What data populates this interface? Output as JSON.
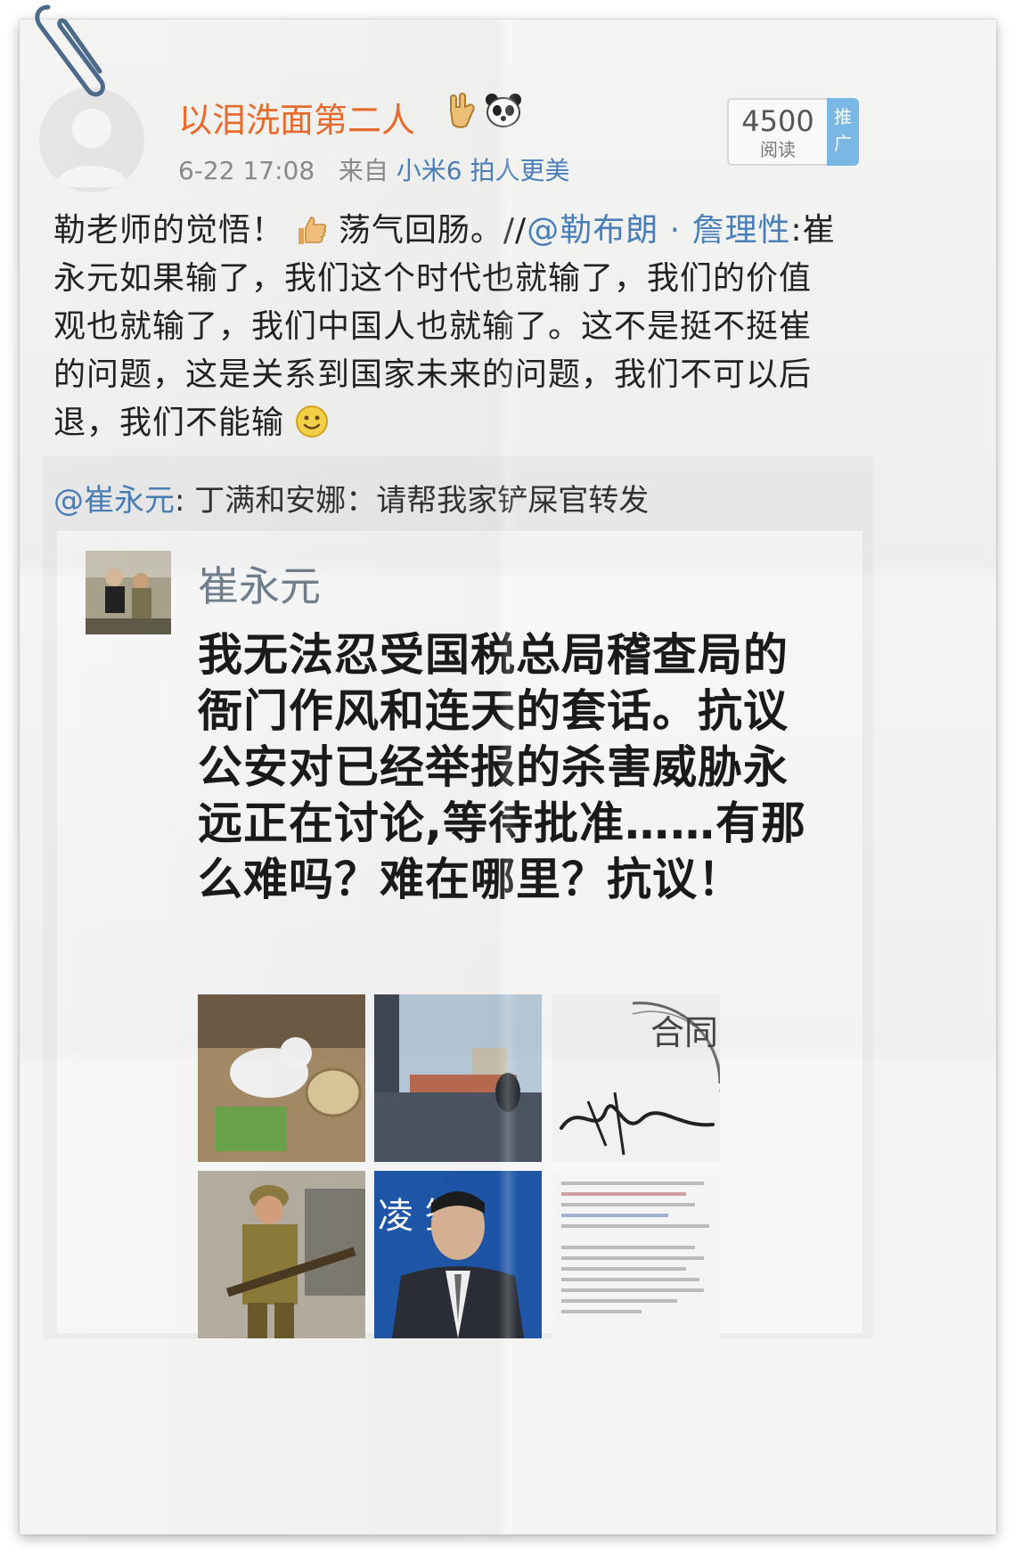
{
  "post": {
    "username": "以泪洗面第二人",
    "time": "6-22 17:08",
    "from_label": "来自",
    "source": "小米6 拍人更美",
    "reads_count": "4500",
    "reads_label": "阅读",
    "promote_label_1": "推",
    "promote_label_2": "广",
    "text_part1": "勒老师的觉悟！",
    "text_part2": "荡气回肠。//",
    "mention": "@勒布朗 · 詹理性",
    "text_part3": ":崔永元如果输了，我们这个时代也就输了，我们的价值观也就输了，我们中国人也就输了。这不是挺不挺崔的问题，这是关系到国家未来的问题，我们不可以后退，我们不能输"
  },
  "repost": {
    "mention": "@崔永元",
    "text": ": 丁满和安娜：请帮我家铲屎官转发",
    "inner_name": "崔永元",
    "inner_text": "我无法忍受国税总局稽查局的衙门作风和连天的套话。抗议公安对已经举报的杀害威胁永远正在讨论,等待批准……有那么难吗？难在哪里？抗议！",
    "thumb_sign_text": "合同",
    "thumb_banner_text": "凌 签"
  },
  "icons": [
    "paperclip-icon",
    "avatar-placeholder-icon",
    "hand-gesture-icon",
    "panda-icon",
    "thumbs-up-icon",
    "smile-emoji-icon"
  ],
  "colors": {
    "username": "#e96c2c",
    "link": "#4b7fb9",
    "promo": "#7bb8e6"
  }
}
